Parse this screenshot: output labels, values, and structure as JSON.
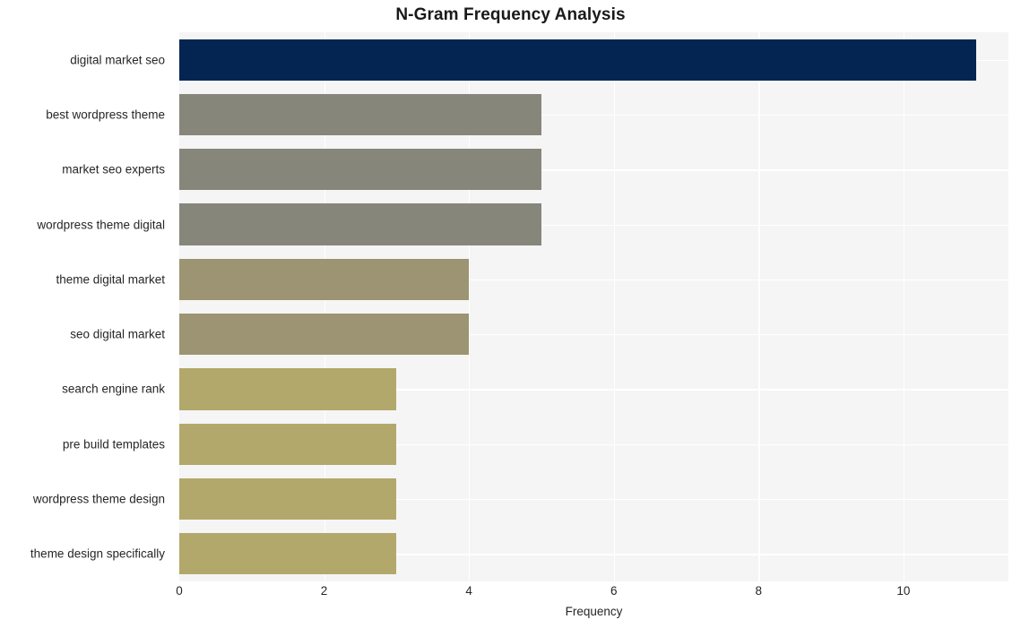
{
  "chart_data": {
    "type": "bar",
    "orientation": "horizontal",
    "title": "N-Gram Frequency Analysis",
    "xlabel": "Frequency",
    "ylabel": "",
    "categories": [
      "digital market seo",
      "best wordpress theme",
      "market seo experts",
      "wordpress theme digital",
      "theme digital market",
      "seo digital market",
      "search engine rank",
      "pre build templates",
      "wordpress theme design",
      "theme design specifically"
    ],
    "values": [
      11,
      5,
      5,
      5,
      4,
      4,
      3,
      3,
      3,
      3
    ],
    "bar_colors": [
      "#042552",
      "#87867b",
      "#87867b",
      "#87867b",
      "#9c9472",
      "#9c9472",
      "#b2a86b",
      "#b2a86b",
      "#b2a86b",
      "#b2a86b"
    ],
    "xlim": [
      0,
      11.45
    ],
    "xticks": [
      0,
      2,
      4,
      6,
      8,
      10
    ],
    "xtick_labels": [
      "0",
      "2",
      "4",
      "6",
      "8",
      "10"
    ],
    "grid": true,
    "gridline_color": "#ffffff",
    "plot_background": "#f5f5f5",
    "figure_background": "#ffffff",
    "legend": null
  }
}
